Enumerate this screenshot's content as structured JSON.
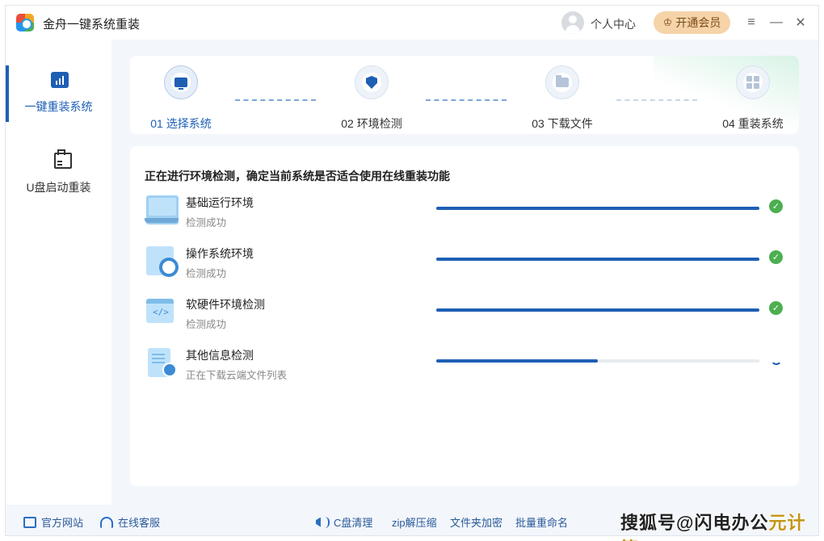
{
  "app": {
    "title": "金舟一键系统重装"
  },
  "titlebar": {
    "user_center": "个人中心",
    "vip_button": "开通会员",
    "icons": {
      "menu": "≡",
      "minimize": "—",
      "close": "✕"
    }
  },
  "sidebar": {
    "items": [
      {
        "label": "一键重装系统",
        "icon": "bar-chart-icon",
        "active": true
      },
      {
        "label": "U盘启动重装",
        "icon": "usb-drive-icon",
        "active": false
      }
    ]
  },
  "steps": [
    {
      "label": "01 选择系统",
      "icon": "monitor-icon",
      "state": "done"
    },
    {
      "label": "02 环境检测",
      "icon": "shield-icon",
      "state": "current"
    },
    {
      "label": "03 下载文件",
      "icon": "folder-icon",
      "state": "pending"
    },
    {
      "label": "04 重装系统",
      "icon": "grid-icon",
      "state": "pending"
    }
  ],
  "main": {
    "heading": "正在进行环境检测，确定当前系统是否适合使用在线重装功能",
    "checks": [
      {
        "title": "基础运行环境",
        "status": "检测成功",
        "progress": 1.0,
        "done": true
      },
      {
        "title": "操作系统环境",
        "status": "检测成功",
        "progress": 1.0,
        "done": true
      },
      {
        "title": "软硬件环境检测",
        "status": "检测成功",
        "progress": 1.0,
        "done": true
      },
      {
        "title": "其他信息检测",
        "status": "正在下载云端文件列表",
        "progress": 0.5,
        "done": false
      }
    ]
  },
  "bottombar": {
    "official_site": "官方网站",
    "online_service": "在线客服",
    "c_clean": "C盘清理",
    "zip": "zip解压缩",
    "folder_encrypt": "文件夹加密",
    "batch_rename": "批量重命名"
  },
  "watermark": {
    "text": "搜狐号@闪电办公",
    "accent": "元计算"
  },
  "colors": {
    "accent": "#1e5fb4",
    "success": "#4caf50",
    "vip_bg": "#f6d3a9"
  }
}
